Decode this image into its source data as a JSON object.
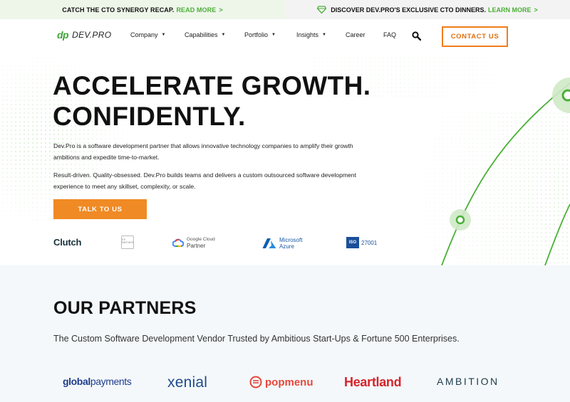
{
  "announcement": {
    "left_text": "CATCH THE CTO SYNERGY RECAP.",
    "left_link": "READ MORE",
    "right_text": "DISCOVER DEV.PRO'S EXCLUSIVE CTO DINNERS.",
    "right_link": "LEARN MORE",
    "chevron": ">"
  },
  "header": {
    "logo_mark": "dp",
    "logo_word": "DEV.PRO",
    "nav": [
      {
        "label": "Company",
        "has_dropdown": true
      },
      {
        "label": "Capabilities",
        "has_dropdown": true
      },
      {
        "label": "Portfolio",
        "has_dropdown": true
      },
      {
        "label": "Insights",
        "has_dropdown": true
      },
      {
        "label": "Career",
        "has_dropdown": false
      },
      {
        "label": "FAQ",
        "has_dropdown": false
      }
    ],
    "caret": "▼",
    "search_icon": "search-icon",
    "contact_label": "CONTACT US"
  },
  "hero": {
    "title_line1": "ACCELERATE GROWTH.",
    "title_line2": "CONFIDENTLY.",
    "para1": "Dev.Pro is a software development partner that allows innovative technology companies to amplify their growth ambitions and expedite time-to-market.",
    "para2": "Result-driven. Quality-obsessed. Dev.Pro builds teams and delivers a custom outsourced software development experience to meet any skillset, complexity, or scale.",
    "cta_label": "TALK TO US",
    "badges": {
      "clutch": "Clutch",
      "ibadge": "ITE PARTNER",
      "gcloud_line1": "Google Cloud",
      "gcloud_line2": "Partner",
      "azure_line1": "Microsoft",
      "azure_line2": "Azure",
      "iso_box": "ISO",
      "iso_num": "27001"
    }
  },
  "partners": {
    "heading": "OUR PARTNERS",
    "subheading": "The Custom Software Development Vendor Trusted by Ambitious Start-Ups & Fortune 500 Enterprises.",
    "logos": {
      "globalpayments_a": "global",
      "globalpayments_b": "payments",
      "xenial": "xenial",
      "popmenu": "popmenu",
      "heartland": "Heartland",
      "ambition": "AMBITION"
    }
  },
  "colors": {
    "brand_green": "#3fa535",
    "accent_orange": "#f08a24",
    "announce_left_bg": "#eef6ea",
    "partners_bg": "#f4f8fb"
  }
}
